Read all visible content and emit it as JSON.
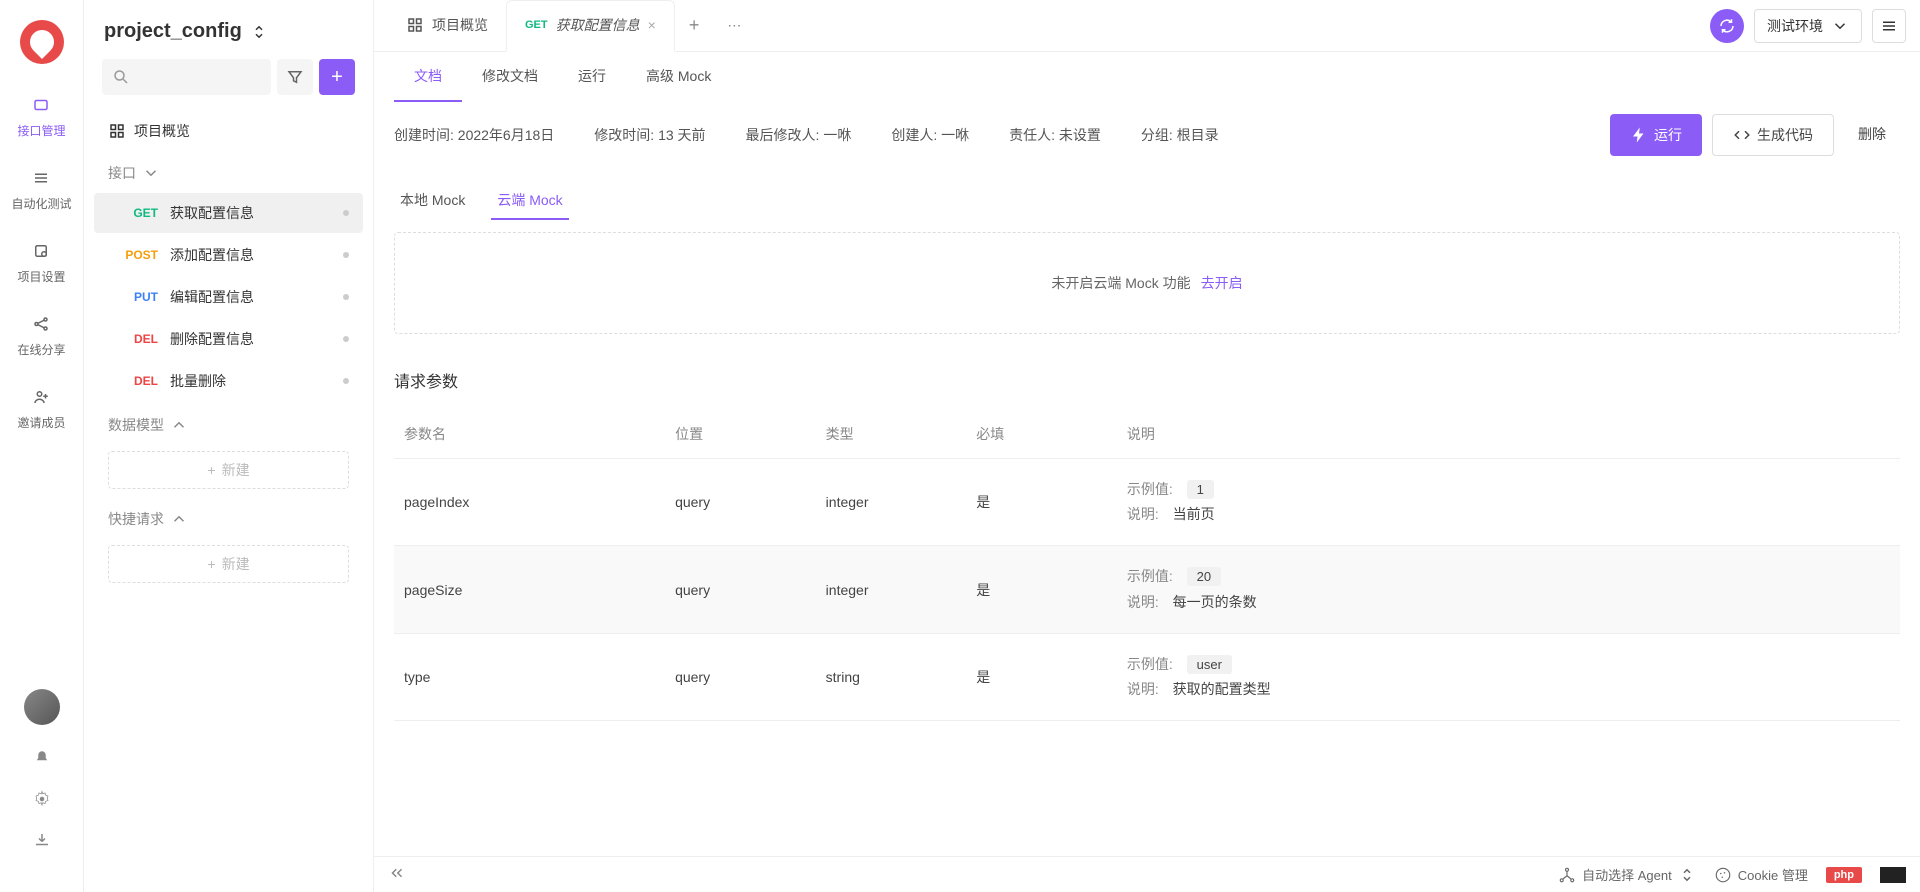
{
  "rail": {
    "items": [
      {
        "label": "接口管理",
        "active": true
      },
      {
        "label": "自动化测试"
      },
      {
        "label": "项目设置"
      },
      {
        "label": "在线分享"
      },
      {
        "label": "邀请成员"
      }
    ]
  },
  "sidebar": {
    "project_title": "project_config",
    "overview_label": "项目概览",
    "sections": {
      "api_label": "接口",
      "data_model_label": "数据模型",
      "quick_request_label": "快捷请求",
      "new_label": "新建"
    },
    "apis": [
      {
        "method": "GET",
        "name": "获取配置信息",
        "active": true
      },
      {
        "method": "POST",
        "name": "添加配置信息"
      },
      {
        "method": "PUT",
        "name": "编辑配置信息"
      },
      {
        "method": "DEL",
        "name": "删除配置信息"
      },
      {
        "method": "DEL",
        "name": "批量删除"
      }
    ]
  },
  "tabs": {
    "overview_label": "项目概览",
    "active_method": "GET",
    "active_name": "获取配置信息"
  },
  "top_right": {
    "env_label": "测试环境"
  },
  "sub_tabs": {
    "doc_label": "文档",
    "edit_doc_label": "修改文档",
    "run_label": "运行",
    "advanced_mock_label": "高级 Mock"
  },
  "meta": {
    "created_label": "创建时间:",
    "created_value": "2022年6月18日",
    "modified_label": "修改时间:",
    "modified_value": "13 天前",
    "last_modifier_label": "最后修改人:",
    "last_modifier_value": "一咻",
    "creator_label": "创建人:",
    "creator_value": "一咻",
    "owner_label": "责任人:",
    "owner_value": "未设置",
    "group_label": "分组:",
    "group_value": "根目录"
  },
  "actions": {
    "run_label": "运行",
    "gen_code_label": "生成代码",
    "delete_label": "删除"
  },
  "mock": {
    "local_label": "本地 Mock",
    "cloud_label": "云端 Mock",
    "not_enabled_text": "未开启云端 Mock 功能",
    "enable_link": "去开启"
  },
  "params": {
    "title": "请求参数",
    "headers": {
      "name": "参数名",
      "location": "位置",
      "type": "类型",
      "required": "必填",
      "desc": "说明"
    },
    "desc_labels": {
      "example": "示例值:",
      "desc": "说明:"
    },
    "rows": [
      {
        "name": "pageIndex",
        "location": "query",
        "type": "integer",
        "required": "是",
        "example": "1",
        "desc": "当前页"
      },
      {
        "name": "pageSize",
        "location": "query",
        "type": "integer",
        "required": "是",
        "example": "20",
        "desc": "每一页的条数"
      },
      {
        "name": "type",
        "location": "query",
        "type": "string",
        "required": "是",
        "example": "user",
        "desc": "获取的配置类型"
      }
    ]
  },
  "footer": {
    "agent_label": "自动选择 Agent",
    "cookie_label": "Cookie 管理",
    "php_label": "php"
  }
}
